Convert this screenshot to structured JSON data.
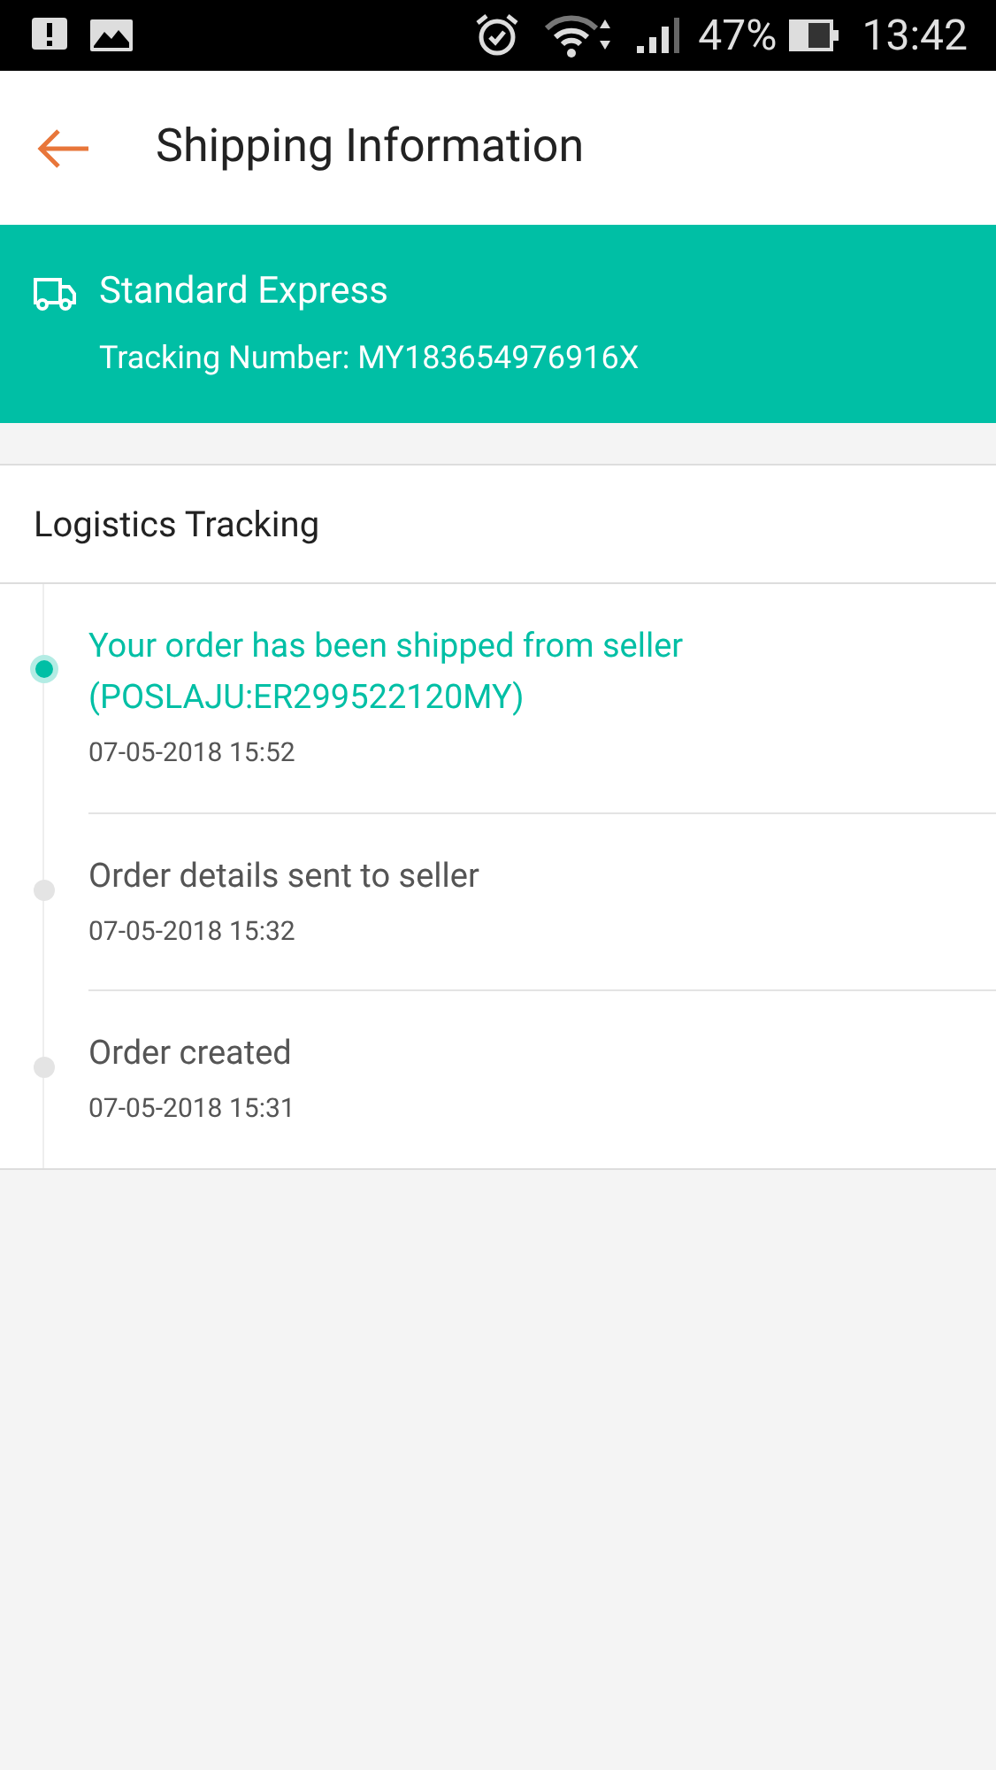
{
  "status_bar": {
    "battery": "47%",
    "time": "13:42"
  },
  "header": {
    "title": "Shipping Information"
  },
  "shipping": {
    "method": "Standard Express",
    "tracking": "Tracking Number: MY183654976916X"
  },
  "logistics": {
    "title": "Logistics Tracking",
    "events": [
      {
        "text": "Your order has been shipped from seller (POSLAJU:ER299522120MY)",
        "time": "07-05-2018 15:52",
        "current": true
      },
      {
        "text": "Order details sent to seller",
        "time": "07-05-2018 15:32",
        "current": false
      },
      {
        "text": "Order created",
        "time": "07-05-2018 15:31",
        "current": false
      }
    ]
  }
}
